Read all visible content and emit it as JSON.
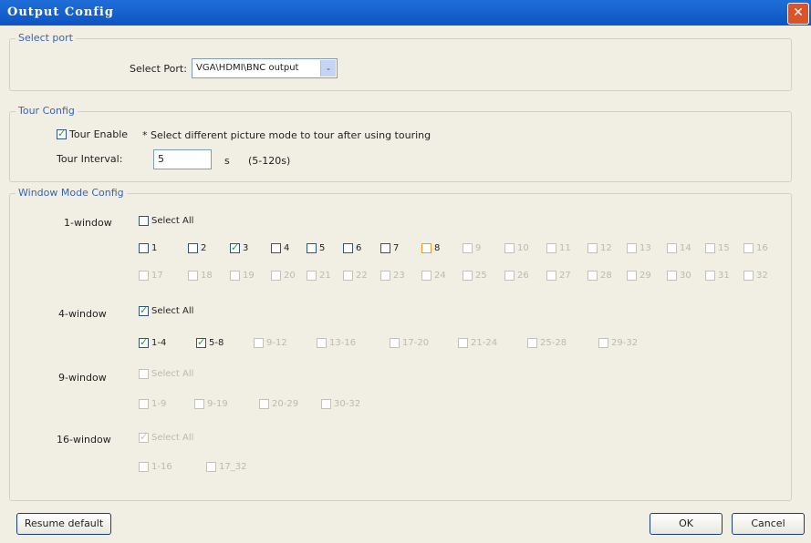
{
  "window": {
    "title": "Output Config",
    "close_glyph": "✕"
  },
  "select_port": {
    "legend": "Select port",
    "label": "Select Port:",
    "value": "VGA\\HDMI\\BNC output",
    "arrow": "⌄"
  },
  "tour": {
    "legend": "Tour Config",
    "enable_label": "Tour Enable",
    "enable_checked": true,
    "note": "* Select different picture mode to tour after using touring",
    "interval_label": "Tour Interval:",
    "interval_value": "5",
    "unit": "s",
    "range": "(5-120s)"
  },
  "window_mode": {
    "legend": "Window Mode Config",
    "one": {
      "label": "1-window",
      "select_all": "Select All",
      "items": [
        "1",
        "2",
        "3",
        "4",
        "5",
        "6",
        "7",
        "8",
        "9",
        "10",
        "11",
        "12",
        "13",
        "14",
        "15",
        "16",
        "17",
        "18",
        "19",
        "20",
        "21",
        "22",
        "23",
        "24",
        "25",
        "26",
        "27",
        "28",
        "29",
        "30",
        "31",
        "32"
      ]
    },
    "four": {
      "label": "4-window",
      "select_all": "Select All",
      "items": [
        "1-4",
        "5-8",
        "9-12",
        "13-16",
        "17-20",
        "21-24",
        "25-28",
        "29-32"
      ]
    },
    "nine": {
      "label": "9-window",
      "select_all": "Select All",
      "items": [
        "1-9",
        "9-19",
        "20-29",
        "30-32"
      ]
    },
    "sixteen": {
      "label": "16-window",
      "select_all": "Select All",
      "items": [
        "1-16",
        "17_32"
      ]
    }
  },
  "buttons": {
    "resume": "Resume default",
    "ok": "OK",
    "cancel": "Cancel"
  }
}
